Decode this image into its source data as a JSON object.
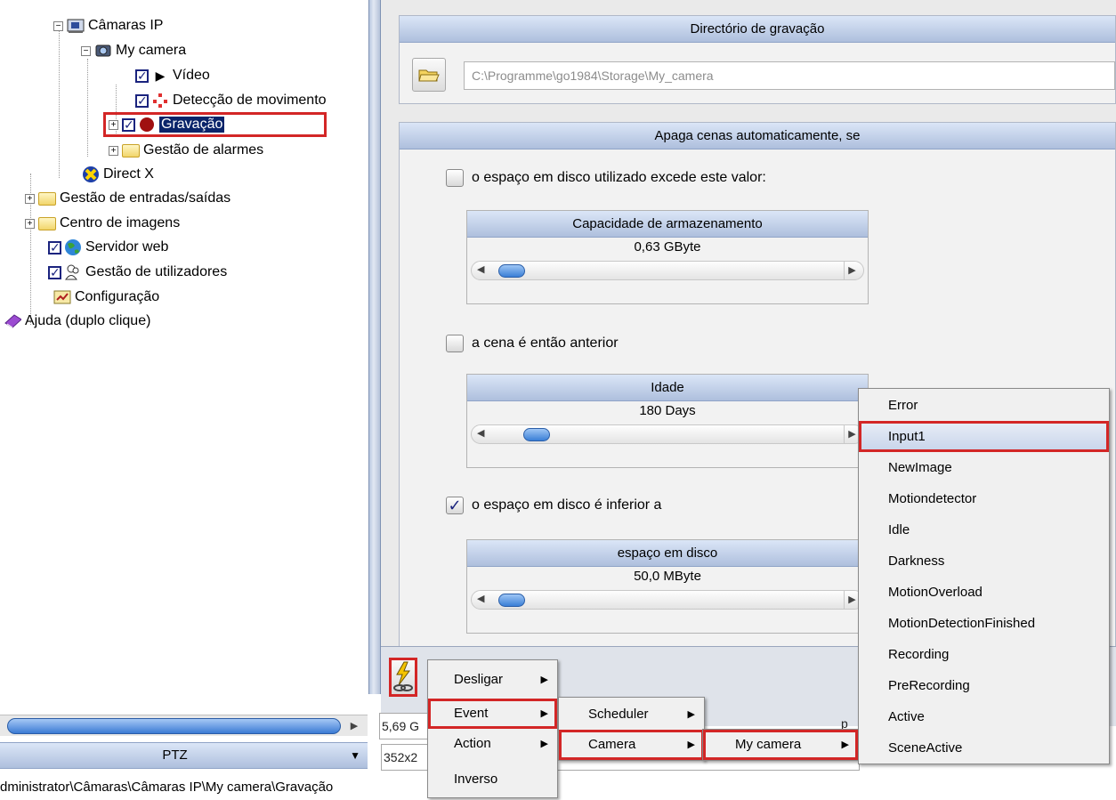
{
  "tree": {
    "items": [
      {
        "label": "Câmaras IP"
      },
      {
        "label": "My camera"
      },
      {
        "label": "Vídeo"
      },
      {
        "label": "Detecção de movimento"
      },
      {
        "label": "Gravação"
      },
      {
        "label": "Gestão de alarmes"
      },
      {
        "label": "Direct X"
      },
      {
        "label": "Gestão de entradas/saídas"
      },
      {
        "label": "Centro de imagens"
      },
      {
        "label": "Servidor web"
      },
      {
        "label": "Gestão de utilizadores"
      },
      {
        "label": "Configuração"
      },
      {
        "label": "Ajuda (duplo clique)"
      }
    ]
  },
  "recording_dir": {
    "header": "Directório de gravação",
    "path": "C:\\Programme\\go1984\\Storage\\My_camera"
  },
  "auto_delete": {
    "header": "Apaga cenas automaticamente, se",
    "options": [
      {
        "label": "o espaço em disco utilizado excede este valor:",
        "checked": false,
        "box_title": "Capacidade de armazenamento",
        "value": "0,63 GByte",
        "slider_level": 0.05
      },
      {
        "label": "a cena é então anterior",
        "checked": false,
        "box_title": "Idade",
        "value": "180 Days",
        "slider_level": 0.12
      },
      {
        "label": "o espaço em disco é inferior a",
        "checked": true,
        "box_title": "espaço em disco",
        "value": "50,0 MByte",
        "slider_level": 0.05
      }
    ]
  },
  "bottom": {
    "cells": [
      "5,69 G",
      "352x2",
      "p"
    ]
  },
  "ptz": {
    "label": "PTZ"
  },
  "status": {
    "path": "dministrator\\Câmaras\\Câmaras IP\\My camera\\Gravação"
  },
  "menu1": {
    "items": [
      "Desligar",
      "Event",
      "Action",
      "Inverso"
    ]
  },
  "menu2": {
    "items": [
      "Scheduler",
      "Camera"
    ]
  },
  "menu3": {
    "items": [
      "My camera"
    ]
  },
  "events": {
    "items": [
      "Error",
      "Input1",
      "NewImage",
      "Motiondetector",
      "Idle",
      "Darkness",
      "MotionOverload",
      "MotionDetectionFinished",
      "Recording",
      "PreRecording",
      "Active",
      "SceneActive"
    ]
  },
  "colors": {
    "highlight": "#d32626",
    "header_blue": "#aebfdd"
  }
}
